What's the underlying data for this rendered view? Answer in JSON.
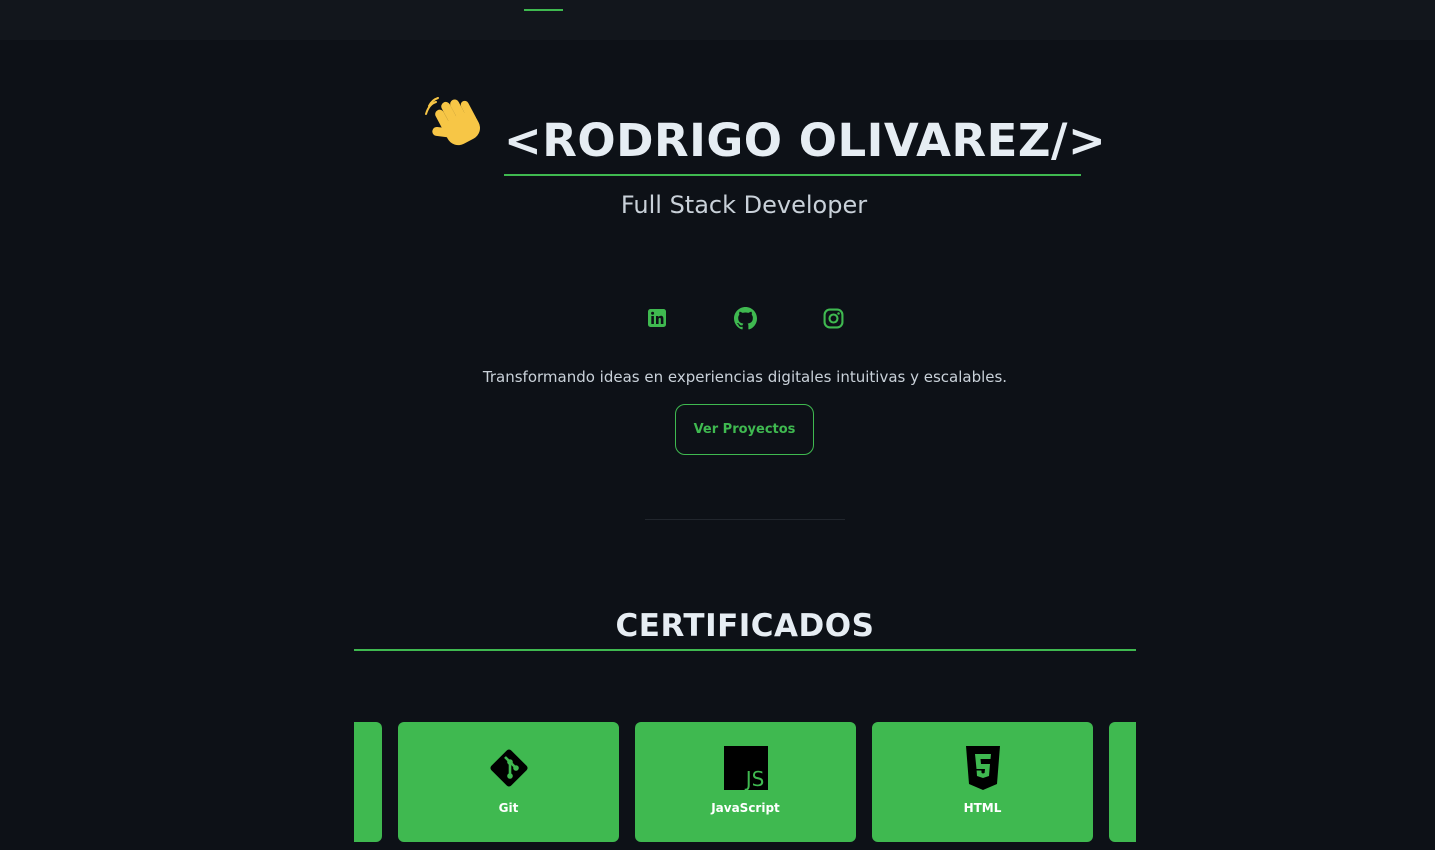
{
  "colors": {
    "background": "#0d1117",
    "topbar": "#12161c",
    "accent": "#3fb950",
    "heading": "#e6edf3",
    "text": "#c9d1d9",
    "card_background": "#3fb950"
  },
  "nav": {
    "active_indicator": true
  },
  "hero": {
    "greeting_icon": "waving-hand-emoji",
    "name": "<RODRIGO OLIVAREZ/>",
    "role": "Full Stack Developer",
    "social_links": [
      {
        "icon": "linkedin-icon"
      },
      {
        "icon": "github-icon"
      },
      {
        "icon": "instagram-icon"
      }
    ],
    "tagline": "Transformando ideas en experiencias digitales intuitivas y escalables.",
    "cta_label": "Ver Proyectos"
  },
  "certificates": {
    "title": "CERTIFICADOS",
    "cards": [
      {
        "label": "Git",
        "icon": "git-icon"
      },
      {
        "label": "JavaScript",
        "icon": "javascript-icon"
      },
      {
        "label": "HTML",
        "icon": "html5-icon"
      }
    ]
  }
}
